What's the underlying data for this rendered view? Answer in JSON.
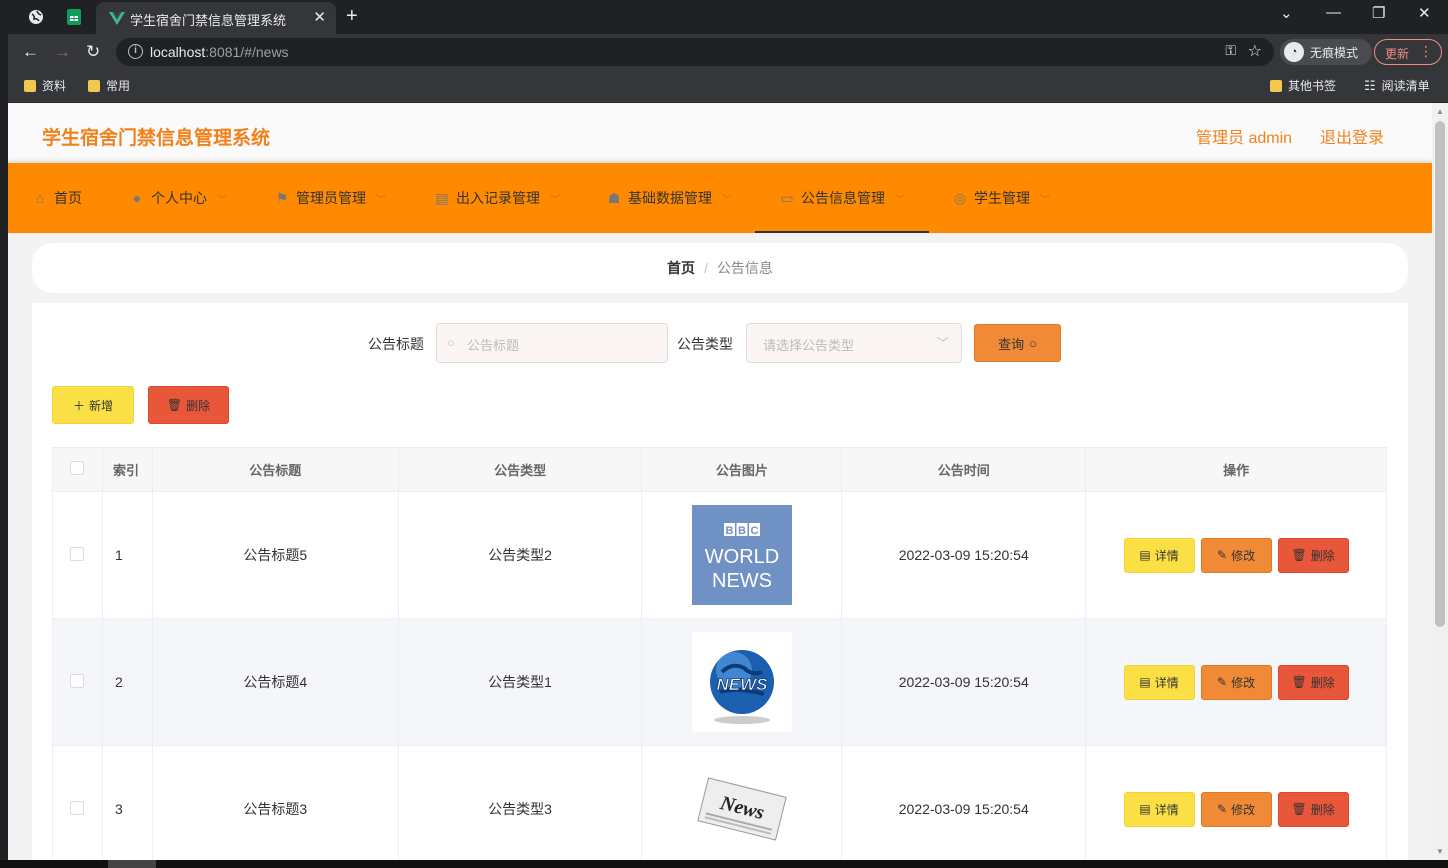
{
  "browser": {
    "tab_title": "学生宿舍门禁信息管理系统",
    "url_host": "localhost",
    "url_path": ":8081/#/news",
    "incognito_label": "无痕模式",
    "update_label": "更新",
    "bookmarks": [
      "资料",
      "常用"
    ],
    "other_bookmarks": "其他书签",
    "reading_list": "阅读清单"
  },
  "header": {
    "brand": "学生宿舍门禁信息管理系统",
    "admin": "管理员 admin",
    "logout": "退出登录"
  },
  "menu": [
    {
      "label": "首页",
      "icon": "home-icon"
    },
    {
      "label": "个人中心",
      "icon": "user-icon"
    },
    {
      "label": "管理员管理",
      "icon": "flag-icon"
    },
    {
      "label": "出入记录管理",
      "icon": "printer-icon"
    },
    {
      "label": "基础数据管理",
      "icon": "thumb-icon"
    },
    {
      "label": "公告信息管理",
      "icon": "chat-icon"
    },
    {
      "label": "学生管理",
      "icon": "compass-icon"
    }
  ],
  "breadcrumb": {
    "home": "首页",
    "current": "公告信息"
  },
  "search": {
    "title_label": "公告标题",
    "title_placeholder": "公告标题",
    "type_label": "公告类型",
    "type_placeholder": "请选择公告类型",
    "query_label": "查询"
  },
  "actions": {
    "add_label": "新增",
    "delete_label": "删除"
  },
  "table": {
    "headers": [
      "索引",
      "公告标题",
      "公告类型",
      "公告图片",
      "公告时间",
      "操作"
    ],
    "rows": [
      {
        "index": "1",
        "title": "公告标题5",
        "type": "公告类型2",
        "image": "bbc-world-news",
        "time": "2022-03-09 15:20:54"
      },
      {
        "index": "2",
        "title": "公告标题4",
        "type": "公告类型1",
        "image": "news-globe",
        "time": "2022-03-09 15:20:54"
      },
      {
        "index": "3",
        "title": "公告标题3",
        "type": "公告类型3",
        "image": "news-paper",
        "time": "2022-03-09 15:20:54"
      }
    ],
    "op_labels": {
      "detail": "详情",
      "edit": "修改",
      "delete": "删除"
    }
  },
  "colors": {
    "accent": "#ff8a00",
    "brand_text": "#f0821e",
    "yellow": "#fbe045",
    "orange": "#f08a36",
    "red": "#e8573a"
  }
}
